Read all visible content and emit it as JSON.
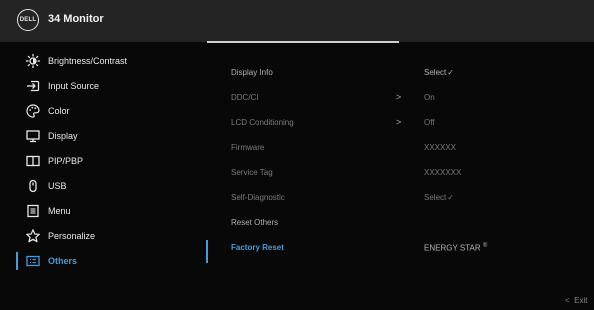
{
  "header": {
    "logo_text": "DELL",
    "title": "34 Monitor"
  },
  "sidebar": {
    "items": [
      {
        "label": "Brightness/Contrast",
        "icon": "brightness-icon"
      },
      {
        "label": "Input Source",
        "icon": "input-source-icon"
      },
      {
        "label": "Color",
        "icon": "color-icon"
      },
      {
        "label": "Display",
        "icon": "display-icon"
      },
      {
        "label": "PIP/PBP",
        "icon": "pip-pbp-icon"
      },
      {
        "label": "USB",
        "icon": "usb-icon"
      },
      {
        "label": "Menu",
        "icon": "menu-icon"
      },
      {
        "label": "Personalize",
        "icon": "star-icon"
      },
      {
        "label": "Others",
        "icon": "others-icon",
        "active": true
      }
    ]
  },
  "main": {
    "rows": [
      {
        "label": "Display Info",
        "value": "Select",
        "has_check": true,
        "state": "enabled"
      },
      {
        "label": "DDC/CI",
        "value": "On",
        "arrow": true,
        "state": "disabled"
      },
      {
        "label": "LCD Conditioning",
        "value": "Off",
        "arrow": true,
        "state": "disabled"
      },
      {
        "label": "Firmware",
        "value": "XXXXXX",
        "state": "disabled"
      },
      {
        "label": "Service Tag",
        "value": "XXXXXXX",
        "state": "disabled"
      },
      {
        "label": "Self-Diagnostic",
        "value": "Select",
        "has_check": true,
        "state": "disabled"
      },
      {
        "label": "Reset Others",
        "value": "",
        "state": "enabled"
      },
      {
        "label": "Factory Reset",
        "value": "ENERGY STAR",
        "reg": "®",
        "state": "selected"
      }
    ],
    "arrow_glyph": ">",
    "check_glyph": "✓"
  },
  "footer": {
    "exit_arrow": "<",
    "exit_label": "Exit"
  },
  "colors": {
    "accent": "#4a9ad8",
    "title_bar": "#242424",
    "background": "#080808"
  }
}
